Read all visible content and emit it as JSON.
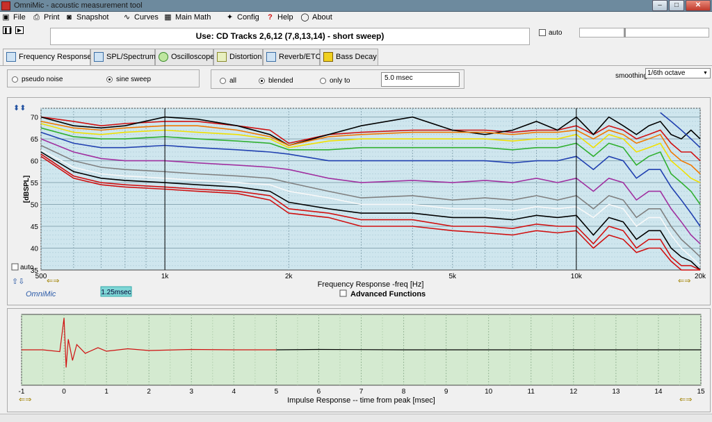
{
  "window": {
    "title": "OmniMic - acoustic measurement tool"
  },
  "menu": [
    {
      "label": "File",
      "icon": "floppy-icon"
    },
    {
      "label": "Print",
      "icon": "printer-icon"
    },
    {
      "label": "Snapshot",
      "icon": "camera-icon"
    },
    {
      "label": "Curves",
      "icon": "curves-icon"
    },
    {
      "label": "Main Math",
      "icon": "calculator-icon"
    },
    {
      "label": "Config",
      "icon": "wrench-icon"
    },
    {
      "label": "Help",
      "icon": "help-icon"
    },
    {
      "label": "About",
      "icon": "speech-icon"
    }
  ],
  "header": {
    "title": "Use: CD Tracks 2,6,12 (7,8,13,14) - short sweep)",
    "auto_label": "auto"
  },
  "tabs": [
    {
      "label": "Frequency Response",
      "active": true
    },
    {
      "label": "SPL/Spectrum"
    },
    {
      "label": "Oscilloscope"
    },
    {
      "label": "Distortion"
    },
    {
      "label": "Reverb/ETC"
    },
    {
      "label": "Bass Decay"
    }
  ],
  "source": {
    "options": [
      "pseudo noise",
      "sine sweep"
    ],
    "selected": "sine sweep"
  },
  "gating": {
    "options": [
      "all",
      "blended",
      "only to"
    ],
    "selected": "blended",
    "value": "5.0 msec"
  },
  "smoothing": {
    "label": "smoothing",
    "value": "1/6th octave"
  },
  "fr_chart": {
    "ylabel": "[dBSPL]",
    "xlabel": "Frequency Response -freq [Hz]",
    "auto_label": "auto",
    "yticks": [
      70,
      65,
      60,
      55,
      50,
      45,
      40,
      35
    ],
    "xtick_labels": [
      {
        "f": 500,
        "t": "500"
      },
      {
        "f": 1000,
        "t": "1k"
      },
      {
        "f": 2000,
        "t": "2k"
      },
      {
        "f": 5000,
        "t": "5k"
      },
      {
        "f": 10000,
        "t": "10k"
      },
      {
        "f": 20000,
        "t": "20k"
      }
    ],
    "cursor_freqs": [
      1000,
      10000
    ],
    "logo": "OmniMic",
    "gate_badge": "1.25msec",
    "advanced_label": "Advanced Functions"
  },
  "ir_chart": {
    "xlabel": "Impulse Response  -- time from peak [msec]",
    "xticks": [
      -1,
      0,
      1,
      2,
      3,
      4,
      5,
      6,
      7,
      8,
      9,
      10,
      11,
      12,
      13,
      14,
      15
    ]
  },
  "chart_data": [
    {
      "type": "line",
      "title": "",
      "xlabel": "Frequency Response -freq [Hz]",
      "ylabel": "[dBSPL]",
      "xscale": "log",
      "xlim": [
        500,
        20000
      ],
      "ylim": [
        35,
        72
      ],
      "grid": true,
      "x": [
        500,
        600,
        700,
        800,
        1000,
        1200,
        1500,
        1800,
        2000,
        2500,
        3000,
        4000,
        5000,
        6000,
        7000,
        8000,
        9000,
        10000,
        11000,
        12000,
        13000,
        14000,
        15000,
        16000,
        17000,
        18000,
        19000,
        20000
      ],
      "series": [
        {
          "color": "#d01010",
          "values": [
            70,
            69,
            68,
            68.5,
            69,
            69,
            68,
            67,
            64,
            66,
            66.5,
            67,
            67,
            67,
            66.5,
            67,
            67,
            68,
            66,
            68,
            67,
            65,
            66,
            67,
            64,
            62,
            62,
            60
          ]
        },
        {
          "color": "#000000",
          "values": [
            70,
            68,
            67.5,
            68,
            70,
            69.5,
            68,
            66,
            63.5,
            66,
            68,
            70,
            67,
            66,
            67,
            69,
            67,
            70,
            66,
            70,
            68,
            66,
            68,
            69,
            66,
            65,
            67,
            65
          ]
        },
        {
          "color": "#f07800",
          "values": [
            69,
            67.5,
            67,
            67.5,
            68,
            68,
            67,
            65.5,
            63.5,
            65.5,
            66,
            66.5,
            66.5,
            66.5,
            66,
            66.5,
            66.5,
            67,
            65,
            67,
            66,
            64,
            65,
            66,
            62,
            60,
            59,
            57
          ]
        },
        {
          "color": "#f0e000",
          "values": [
            68.5,
            66.5,
            66,
            66.5,
            67,
            66.5,
            66,
            65,
            63,
            64.5,
            65,
            65,
            65,
            65,
            64.5,
            65,
            65,
            66,
            63,
            66,
            65,
            62,
            63,
            64,
            60,
            58,
            56,
            55
          ]
        },
        {
          "color": "#30b030",
          "values": [
            67.5,
            65.5,
            65,
            65,
            65.5,
            65,
            64.5,
            64,
            62.5,
            62.5,
            63,
            63,
            63,
            63,
            62.5,
            63,
            63,
            64,
            61,
            64,
            63,
            59,
            61,
            62,
            57,
            55,
            53,
            50
          ]
        },
        {
          "color": "#2040b0",
          "values": [
            66.5,
            64,
            63,
            63,
            63.5,
            63,
            62.5,
            62,
            61.5,
            60,
            60,
            60,
            60,
            60,
            59.5,
            60,
            60,
            61,
            58,
            61,
            60,
            56,
            58,
            58,
            54,
            51,
            48,
            45
          ]
        },
        {
          "color": "#a030a0",
          "values": [
            65,
            62,
            60.5,
            60,
            60,
            59.5,
            59,
            58.5,
            58,
            56,
            55,
            55.5,
            55,
            55.5,
            55,
            56,
            55,
            56,
            53,
            56,
            55,
            51,
            53,
            53,
            49,
            46,
            43,
            41
          ]
        },
        {
          "color": "#808080",
          "values": [
            63.5,
            60,
            58.5,
            58,
            57.5,
            57,
            56.5,
            56,
            55,
            53,
            51.5,
            52,
            51,
            51.5,
            51,
            52,
            51,
            52,
            49,
            52,
            51,
            47,
            49,
            49,
            45,
            42,
            40,
            38
          ]
        },
        {
          "color": "#f8f8f8",
          "values": [
            62.5,
            58.5,
            57,
            56.5,
            56,
            55.5,
            55,
            54.5,
            53,
            51.5,
            50,
            50,
            49,
            49,
            48.5,
            49.5,
            49,
            49.5,
            47,
            50,
            49,
            45,
            47,
            47,
            43,
            40,
            38,
            36
          ]
        },
        {
          "color": "#000000",
          "values": [
            62,
            57.5,
            56,
            55.5,
            55,
            54.5,
            54,
            53,
            50.5,
            49,
            48,
            48,
            47,
            47,
            46.5,
            47.5,
            47,
            47.5,
            43,
            47,
            46,
            42,
            44,
            44,
            40,
            38,
            37,
            35
          ]
        },
        {
          "color": "#d01010",
          "values": [
            61.5,
            56.5,
            55,
            54.5,
            54,
            53.5,
            53,
            52,
            49,
            48,
            46.5,
            46.5,
            45,
            45,
            44.5,
            45.5,
            45,
            45,
            41,
            45,
            44,
            40,
            42,
            42,
            38,
            36,
            36,
            35
          ]
        },
        {
          "color": "#d01010",
          "values": [
            61,
            56,
            54.5,
            54,
            53.5,
            53,
            52.5,
            51,
            48,
            47,
            45,
            45,
            44,
            43.5,
            43,
            44,
            43.5,
            44,
            40,
            43,
            42,
            39,
            40,
            40,
            37,
            35,
            35,
            35
          ]
        },
        {
          "color": "#2040b0",
          "values": [
            null,
            null,
            null,
            null,
            null,
            null,
            null,
            null,
            null,
            null,
            null,
            null,
            null,
            null,
            null,
            null,
            null,
            null,
            null,
            null,
            null,
            null,
            null,
            71,
            69,
            67,
            65,
            63
          ]
        }
      ]
    },
    {
      "type": "line",
      "title": "",
      "xlabel": "Impulse Response  -- time from peak [msec]",
      "ylabel": "",
      "xlim": [
        -1,
        15
      ],
      "ylim": [
        -1,
        1
      ],
      "grid": true,
      "x": [
        -1,
        -0.5,
        -0.1,
        0,
        0.05,
        0.1,
        0.2,
        0.3,
        0.5,
        0.8,
        1,
        1.5,
        2,
        3,
        4,
        5,
        6,
        8,
        10,
        12,
        14,
        15
      ],
      "series": [
        {
          "color": "#d01010",
          "values": [
            0,
            0,
            -0.05,
            0.9,
            -0.5,
            0.3,
            -0.3,
            0.15,
            -0.1,
            0.06,
            -0.04,
            0.03,
            -0.02,
            0.01,
            0,
            0,
            null,
            null,
            null,
            null,
            null,
            null
          ]
        },
        {
          "color": "#000000",
          "values": [
            null,
            null,
            null,
            null,
            null,
            null,
            null,
            null,
            null,
            null,
            null,
            null,
            null,
            null,
            null,
            0,
            0.01,
            0,
            0,
            0,
            0,
            0
          ]
        }
      ]
    }
  ]
}
